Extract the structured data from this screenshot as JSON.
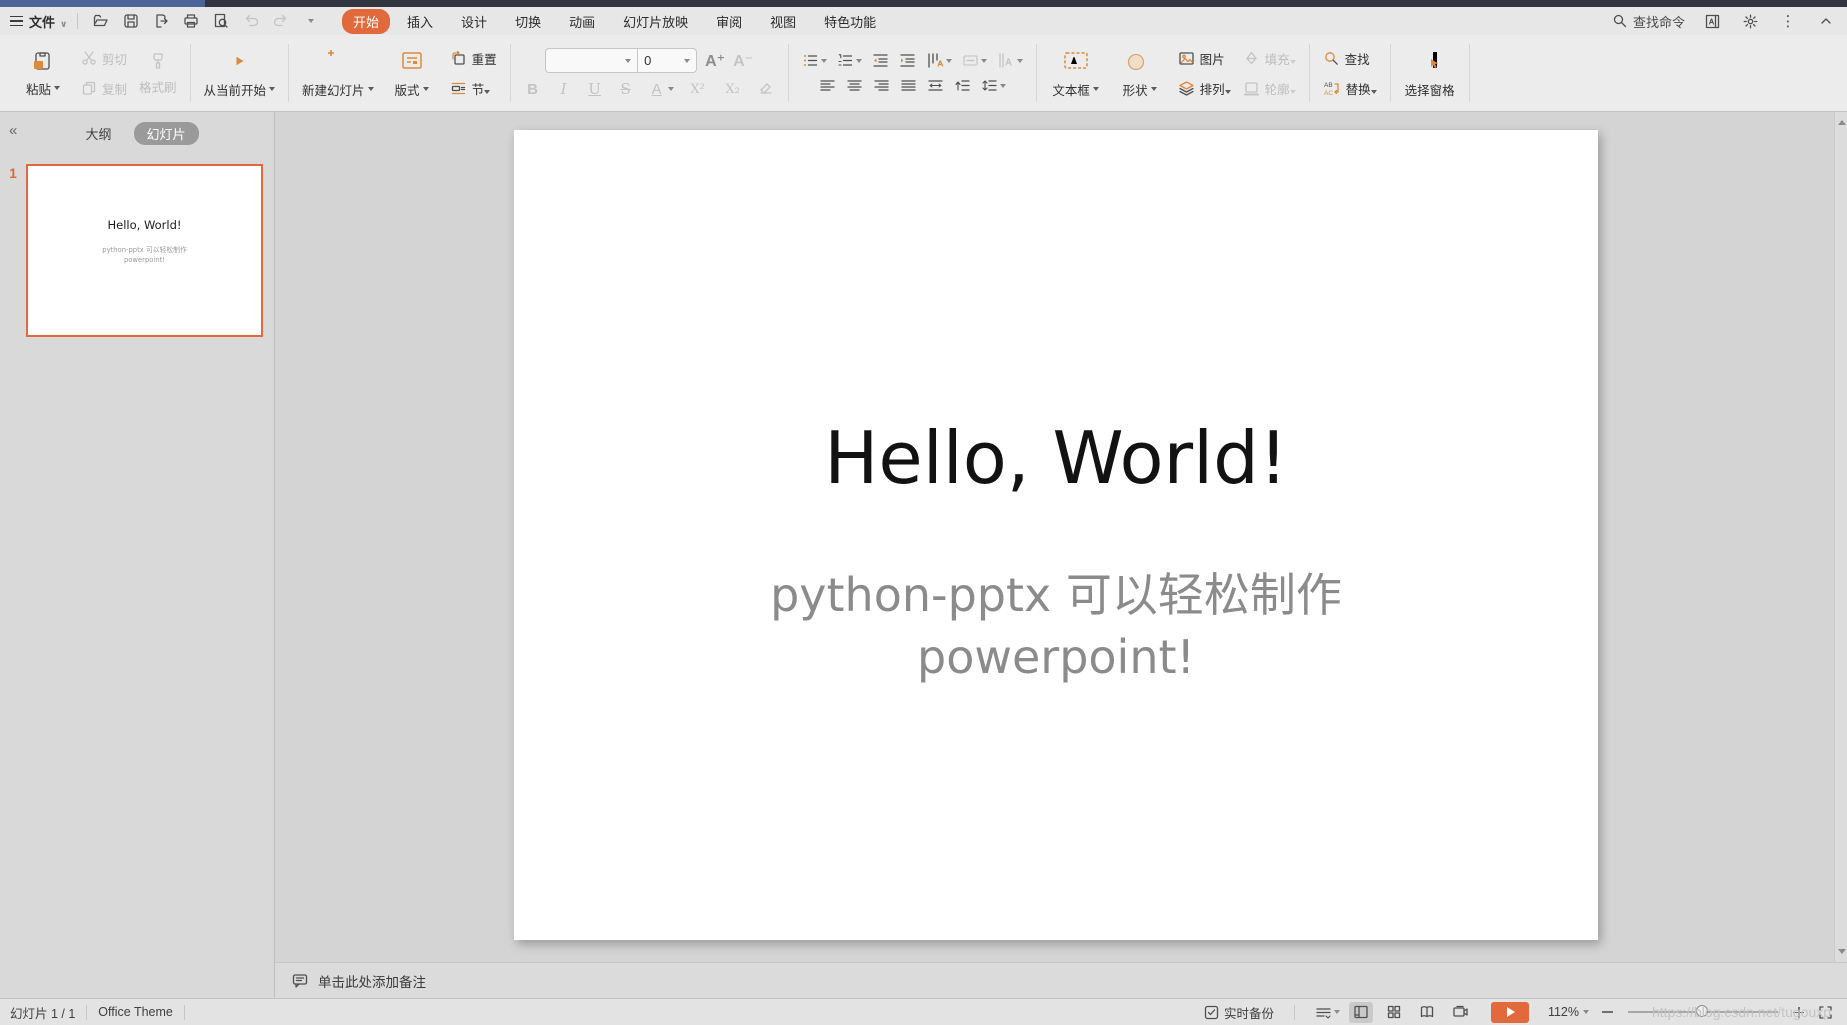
{
  "menubar": {
    "file": "文件",
    "tabs": [
      {
        "label": "开始",
        "active": true
      },
      {
        "label": "插入"
      },
      {
        "label": "设计"
      },
      {
        "label": "切换"
      },
      {
        "label": "动画"
      },
      {
        "label": "幻灯片放映"
      },
      {
        "label": "审阅"
      },
      {
        "label": "视图"
      },
      {
        "label": "特色功能"
      }
    ],
    "find_command": "查找命令"
  },
  "ribbon": {
    "paste": "粘贴",
    "cut": "剪切",
    "copy": "复制",
    "format_painter": "格式刷",
    "play_from_current": "从当前开始",
    "new_slide": "新建幻灯片",
    "layout": "版式",
    "reset": "重置",
    "section": "节",
    "font_size_value": "0",
    "bold": "B",
    "italic": "I",
    "underline": "U",
    "strikethrough": "S",
    "font_color": "A",
    "superscript": "X²",
    "subscript": "X₂",
    "increase_font": "A⁺",
    "decrease_font": "A⁻",
    "textbox": "文本框",
    "shapes": "形状",
    "picture": "图片",
    "fill": "填充",
    "arrange": "排列",
    "outline": "轮廓",
    "find": "查找",
    "replace": "替换",
    "selection_pane": "选择窗格"
  },
  "sidebar": {
    "collapse": "«",
    "tab_outline": "大纲",
    "tab_slides": "幻灯片",
    "slide_number": "1"
  },
  "slide": {
    "title": "Hello, World!",
    "subtitle": "python-pptx 可以轻松制作\npowerpoint!"
  },
  "notes": {
    "placeholder": "单击此处添加备注"
  },
  "statusbar": {
    "slide_counter": "幻灯片 1 / 1",
    "theme_name": "Office Theme",
    "live_backup": "实时备份",
    "zoom_level": "112%"
  },
  "watermark": "https://blog.csdn.net/tugouxp",
  "colors": {
    "accent_orange": "#e2693c",
    "titlebar_blue": "#4a6596",
    "titlebar_dark": "#30353f"
  }
}
